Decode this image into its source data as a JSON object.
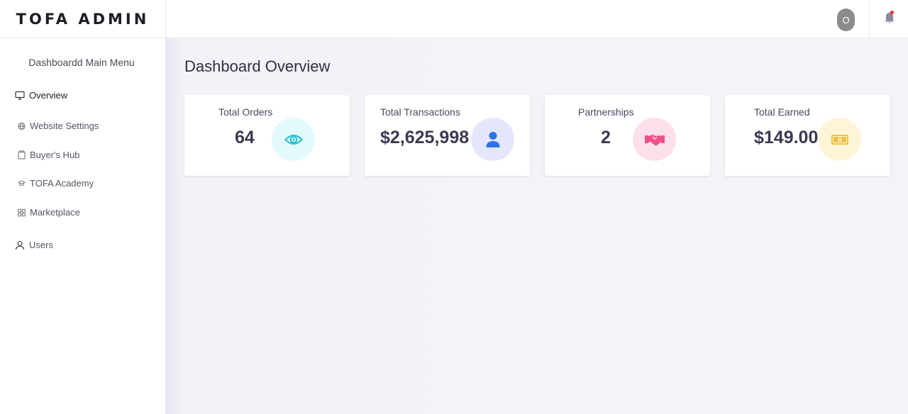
{
  "app": {
    "brand": "TOFA ADMIN",
    "user_initial": "O"
  },
  "sidebar": {
    "title": "Dashboardd Main Menu",
    "items": [
      {
        "label": "Overview",
        "icon": "monitor-icon",
        "active": true
      },
      {
        "label": "Website Settings",
        "icon": "globe-icon"
      },
      {
        "label": "Buyer's Hub",
        "icon": "clipboard-icon"
      },
      {
        "label": "TOFA Academy",
        "icon": "graduation-cap-icon"
      },
      {
        "label": "Marketplace",
        "icon": "grid-icon"
      },
      {
        "label": "Users",
        "icon": "user-icon"
      }
    ]
  },
  "main": {
    "title": "Dashboard Overview",
    "cards": [
      {
        "label": "Total Orders",
        "value": "64",
        "icon": "eye-icon",
        "icon_color": "#2bc0cf",
        "icon_bg": "#e3fafd"
      },
      {
        "label": "Total Transactions",
        "value": "$2,625,998",
        "icon": "user-icon",
        "icon_color": "#2e73e8",
        "icon_bg": "#e4e6fb"
      },
      {
        "label": "Partnerships",
        "value": "2",
        "icon": "handshake-icon",
        "icon_color": "#f0518a",
        "icon_bg": "#fde0ea"
      },
      {
        "label": "Total Earned",
        "value": "$149.00",
        "icon": "money-icon",
        "icon_color": "#f3bf3b",
        "icon_bg": "#fff4d8"
      }
    ]
  },
  "colors": {
    "notification_dot": "#e53935",
    "bell": "#8b8b9b",
    "avatar_bg": "#8b8b8b"
  }
}
